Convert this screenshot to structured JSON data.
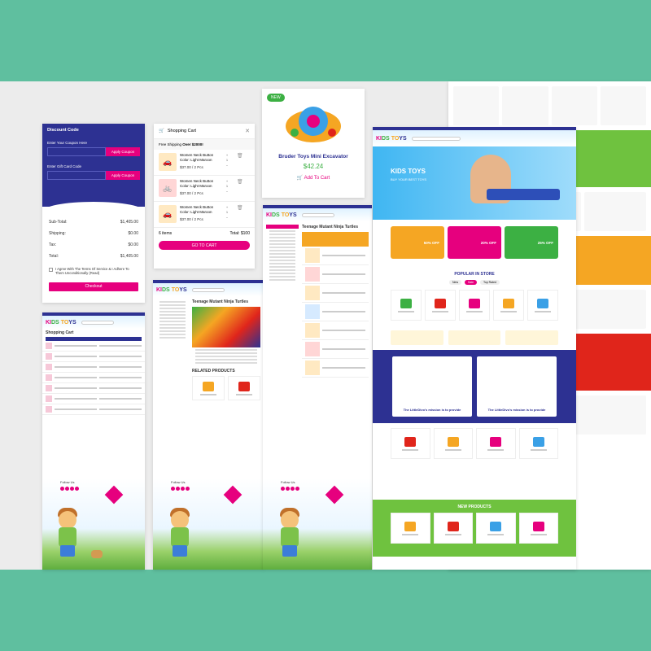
{
  "coupon": {
    "title": "Discount Code",
    "coupon_label": "Enter Your Coupon Here",
    "apply1": "Apply Coupon",
    "gift_label": "Enter Gift Card Code",
    "apply2": "Apply Coupon",
    "subtotal_label": "Sub-Total:",
    "subtotal": "$1,405.00",
    "shipping_label": "Shipping:",
    "shipping": "$0.00",
    "tax_label": "Tax:",
    "tax": "$0.00",
    "total_label": "Total:",
    "total": "$1,405.00",
    "agree": "I Agree With The Terms Of Service & I Adhere To Them Unconditionally (Read)",
    "checkout": "Checkout"
  },
  "cart": {
    "title": "Shopping Cart",
    "shipping_msg_prefix": "Free Shipping ",
    "shipping_msg_bold": "Over $2000!",
    "items": [
      {
        "name": "Women Neck Button Color: Light Maroon",
        "price": "$37.00 / 2 Pcs",
        "qty": "1"
      },
      {
        "name": "Women Neck Button Color: Light Maroon",
        "price": "$37.00 / 2 Pcs",
        "qty": "1"
      },
      {
        "name": "Women Neck Button Color: Light Maroon",
        "price": "$37.00 / 2 Pcs",
        "qty": "1"
      }
    ],
    "count": "6 items",
    "total": "Total: $100",
    "goto": "GO TO CART"
  },
  "product": {
    "badge": "NEW",
    "name": "Bruder Toys Mini Excavator",
    "price": "$42.24",
    "add": "Add To Cart"
  },
  "brand": {
    "k": "KI",
    "i": "DS",
    "d": "TO",
    "s": "YS"
  },
  "pages": {
    "cart_page_title": "Shopping Cart",
    "product_title": "Teenage Mutant Ninja Turtles",
    "related": "RELATED PRODUCTS",
    "follow": "Follow Us"
  },
  "home": {
    "hero_title": "KIDS TOYS",
    "hero_sub": "BUY YOUR BEST TOYS",
    "banner1": "50% OFF",
    "banner2": "20% OFF",
    "banner3": "25% OFF",
    "popular": "POPULAR IN STORE",
    "tab1": "New",
    "tab2": "Sale",
    "tab3": "Top Rated",
    "mission": "The LittleDivo's mission is to provide",
    "new_products": "NEW PRODUCTS"
  },
  "colors": {
    "navy": "#2d3192",
    "magenta": "#e6007e",
    "green": "#3cb043",
    "teal": "#5fbf9f"
  }
}
